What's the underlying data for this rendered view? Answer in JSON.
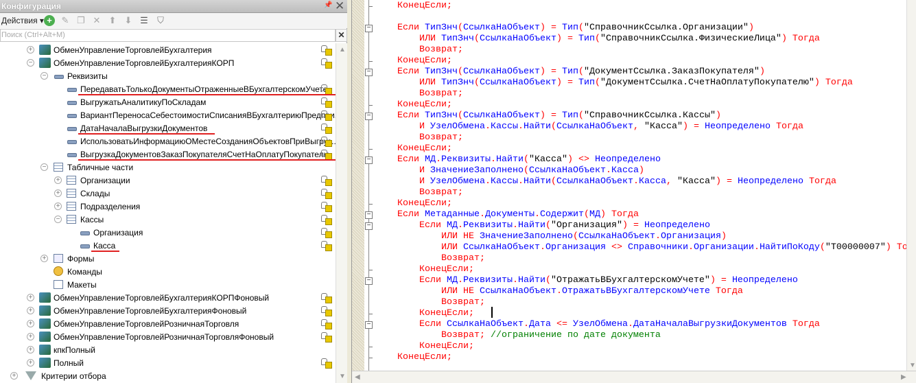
{
  "panel": {
    "title": "Конфигурация",
    "actions_label": "Действия ▾",
    "search_placeholder": "Поиск (Ctrl+Alt+M)",
    "toolbar_icons": [
      "add-icon",
      "edit-icon",
      "copy-icon",
      "delete-icon",
      "move-up-icon",
      "move-down-icon",
      "sort-icon",
      "filter-icon"
    ]
  },
  "tree": [
    {
      "label": "ОбменУправлениеТорговлейБухгалтерия",
      "level": 0,
      "expander": "plus",
      "icon": "exch",
      "lock": true
    },
    {
      "label": "ОбменУправлениеТорговлейБухгалтерияКОРП",
      "level": 0,
      "expander": "minus",
      "icon": "exch",
      "lock": true
    },
    {
      "label": "Реквизиты",
      "level": 1,
      "expander": "minus",
      "icon": "attr",
      "lock": false
    },
    {
      "label": "ПередаватьТолькоДокументыОтраженныеВБухгалтерскомУчете",
      "level": 2,
      "expander": "none",
      "icon": "attr",
      "lock": true,
      "highlight": true
    },
    {
      "label": "ВыгружатьАналитикуПоСкладам",
      "level": 2,
      "expander": "none",
      "icon": "attr",
      "lock": true
    },
    {
      "label": "ВариантПереносаСебестоимостиСписанияВБухгалтериюПредпри...",
      "level": 2,
      "expander": "none",
      "icon": "attr",
      "lock": true
    },
    {
      "label": "ДатаНачалаВыгрузкиДокументов",
      "level": 2,
      "expander": "none",
      "icon": "attr",
      "lock": true,
      "highlight": true
    },
    {
      "label": "ИспользоватьИнформациюОМестеСозданияОбъектовПриВыгруз...",
      "level": 2,
      "expander": "none",
      "icon": "attr",
      "lock": true
    },
    {
      "label": "ВыгрузкаДокументовЗаказПокупателяСчетНаОплатуПокупателю",
      "level": 2,
      "expander": "none",
      "icon": "attr",
      "lock": true,
      "highlight": true
    },
    {
      "label": "Табличные части",
      "level": 1,
      "expander": "minus",
      "icon": "tbl",
      "lock": false
    },
    {
      "label": "Организации",
      "level": 2,
      "expander": "plus",
      "icon": "tbl",
      "lock": true
    },
    {
      "label": "Склады",
      "level": 2,
      "expander": "plus",
      "icon": "tbl",
      "lock": true
    },
    {
      "label": "Подразделения",
      "level": 2,
      "expander": "plus",
      "icon": "tbl",
      "lock": true
    },
    {
      "label": "Кассы",
      "level": 2,
      "expander": "minus",
      "icon": "tbl",
      "lock": true
    },
    {
      "label": "Организация",
      "level": 3,
      "expander": "none",
      "icon": "attr",
      "lock": true
    },
    {
      "label": "Касса",
      "level": 3,
      "expander": "none",
      "icon": "attr",
      "lock": true,
      "highlight": true
    },
    {
      "label": "Формы",
      "level": 1,
      "expander": "plus",
      "icon": "form",
      "lock": false
    },
    {
      "label": "Команды",
      "level": 1,
      "expander": "none",
      "icon": "cmd",
      "lock": false
    },
    {
      "label": "Макеты",
      "level": 1,
      "expander": "none",
      "icon": "tpl",
      "lock": false
    },
    {
      "label": "ОбменУправлениеТорговлейБухгалтерияКОРПФоновый",
      "level": 0,
      "expander": "plus",
      "icon": "exch",
      "lock": true
    },
    {
      "label": "ОбменУправлениеТорговлейБухгалтерияФоновый",
      "level": 0,
      "expander": "plus",
      "icon": "exch",
      "lock": true
    },
    {
      "label": "ОбменУправлениеТорговлейРозничнаяТорговля",
      "level": 0,
      "expander": "plus",
      "icon": "exch",
      "lock": true
    },
    {
      "label": "ОбменУправлениеТорговлейРозничнаяТорговляФоновый",
      "level": 0,
      "expander": "plus",
      "icon": "exch",
      "lock": true
    },
    {
      "label": "кпкПолный",
      "level": 0,
      "expander": "plus",
      "icon": "exch",
      "lock": false
    },
    {
      "label": "Полный",
      "level": 0,
      "expander": "plus",
      "icon": "exch",
      "lock": true
    },
    {
      "label": "Критерии отбора",
      "level": -1,
      "expander": "plus",
      "icon": "flt",
      "lock": false
    }
  ],
  "code": [
    {
      "indent": 1,
      "fold": "end",
      "t": [
        [
          "k",
          "КонецЕсли;"
        ]
      ]
    },
    {
      "indent": 0,
      "fold": "",
      "t": []
    },
    {
      "indent": 1,
      "fold": "start",
      "t": [
        [
          "k",
          "Если "
        ],
        [
          "i",
          "ТипЗнч"
        ],
        [
          "k",
          "("
        ],
        [
          "i",
          "СсылкаНаОбъект"
        ],
        [
          "k",
          ") = "
        ],
        [
          "i",
          "Тип"
        ],
        [
          "k",
          "("
        ],
        [
          "s",
          "\"СправочникСсылка.Организации\""
        ],
        [
          "k",
          ")"
        ]
      ]
    },
    {
      "indent": 2,
      "fold": "",
      "t": [
        [
          "k",
          "ИЛИ "
        ],
        [
          "i",
          "ТипЗнч"
        ],
        [
          "k",
          "("
        ],
        [
          "i",
          "СсылкаНаОбъект"
        ],
        [
          "k",
          ") = "
        ],
        [
          "i",
          "Тип"
        ],
        [
          "k",
          "("
        ],
        [
          "s",
          "\"СправочникСсылка.ФизическиеЛица\""
        ],
        [
          "k",
          ") Тогда"
        ]
      ]
    },
    {
      "indent": 2,
      "fold": "",
      "t": [
        [
          "k",
          "Возврат;"
        ]
      ]
    },
    {
      "indent": 1,
      "fold": "end",
      "t": [
        [
          "k",
          "КонецЕсли;"
        ]
      ]
    },
    {
      "indent": 1,
      "fold": "start",
      "t": [
        [
          "k",
          "Если "
        ],
        [
          "i",
          "ТипЗнч"
        ],
        [
          "k",
          "("
        ],
        [
          "i",
          "СсылкаНаОбъект"
        ],
        [
          "k",
          ") = "
        ],
        [
          "i",
          "Тип"
        ],
        [
          "k",
          "("
        ],
        [
          "s",
          "\"ДокументСсылка.ЗаказПокупателя\""
        ],
        [
          "k",
          ")"
        ]
      ]
    },
    {
      "indent": 2,
      "fold": "",
      "t": [
        [
          "k",
          "ИЛИ "
        ],
        [
          "i",
          "ТипЗнч"
        ],
        [
          "k",
          "("
        ],
        [
          "i",
          "СсылкаНаОбъект"
        ],
        [
          "k",
          ") = "
        ],
        [
          "i",
          "Тип"
        ],
        [
          "k",
          "("
        ],
        [
          "s",
          "\"ДокументСсылка.СчетНаОплатуПокупателю\""
        ],
        [
          "k",
          ") Тогда"
        ]
      ]
    },
    {
      "indent": 2,
      "fold": "",
      "t": [
        [
          "k",
          "Возврат;"
        ]
      ]
    },
    {
      "indent": 1,
      "fold": "end",
      "t": [
        [
          "k",
          "КонецЕсли;"
        ]
      ]
    },
    {
      "indent": 1,
      "fold": "start",
      "t": [
        [
          "k",
          "Если "
        ],
        [
          "i",
          "ТипЗнч"
        ],
        [
          "k",
          "("
        ],
        [
          "i",
          "СсылкаНаОбъект"
        ],
        [
          "k",
          ") = "
        ],
        [
          "i",
          "Тип"
        ],
        [
          "k",
          "("
        ],
        [
          "s",
          "\"СправочникСсылка.Кассы\""
        ],
        [
          "k",
          ")"
        ]
      ]
    },
    {
      "indent": 2,
      "fold": "",
      "t": [
        [
          "k",
          "И "
        ],
        [
          "i",
          "УзелОбмена"
        ],
        [
          "k",
          "."
        ],
        [
          "i",
          "Кассы"
        ],
        [
          "k",
          "."
        ],
        [
          "i",
          "Найти"
        ],
        [
          "k",
          "("
        ],
        [
          "i",
          "СсылкаНаОбъект"
        ],
        [
          "k",
          ", "
        ],
        [
          "s",
          "\"Касса\""
        ],
        [
          "k",
          ") = "
        ],
        [
          "i",
          "Неопределено"
        ],
        [
          "k",
          " Тогда"
        ]
      ]
    },
    {
      "indent": 2,
      "fold": "",
      "t": [
        [
          "k",
          "Возврат;"
        ]
      ]
    },
    {
      "indent": 1,
      "fold": "end",
      "t": [
        [
          "k",
          "КонецЕсли;"
        ]
      ]
    },
    {
      "indent": 1,
      "fold": "start",
      "t": [
        [
          "k",
          "Если "
        ],
        [
          "i",
          "МД"
        ],
        [
          "k",
          "."
        ],
        [
          "i",
          "Реквизиты"
        ],
        [
          "k",
          "."
        ],
        [
          "i",
          "Найти"
        ],
        [
          "k",
          "("
        ],
        [
          "s",
          "\"Касса\""
        ],
        [
          "k",
          ") <> "
        ],
        [
          "i",
          "Неопределено"
        ]
      ]
    },
    {
      "indent": 2,
      "fold": "",
      "t": [
        [
          "k",
          "И "
        ],
        [
          "i",
          "ЗначениеЗаполнено"
        ],
        [
          "k",
          "("
        ],
        [
          "i",
          "СсылкаНаОбъект"
        ],
        [
          "k",
          "."
        ],
        [
          "i",
          "Касса"
        ],
        [
          "k",
          ")"
        ]
      ]
    },
    {
      "indent": 2,
      "fold": "",
      "t": [
        [
          "k",
          "И "
        ],
        [
          "i",
          "УзелОбмена"
        ],
        [
          "k",
          "."
        ],
        [
          "i",
          "Кассы"
        ],
        [
          "k",
          "."
        ],
        [
          "i",
          "Найти"
        ],
        [
          "k",
          "("
        ],
        [
          "i",
          "СсылкаНаОбъект"
        ],
        [
          "k",
          "."
        ],
        [
          "i",
          "Касса"
        ],
        [
          "k",
          ", "
        ],
        [
          "s",
          "\"Касса\""
        ],
        [
          "k",
          ") = "
        ],
        [
          "i",
          "Неопределено"
        ],
        [
          "k",
          " Тогда"
        ]
      ]
    },
    {
      "indent": 2,
      "fold": "",
      "t": [
        [
          "k",
          "Возврат;"
        ]
      ]
    },
    {
      "indent": 1,
      "fold": "end",
      "t": [
        [
          "k",
          "КонецЕсли;"
        ]
      ]
    },
    {
      "indent": 1,
      "fold": "start",
      "t": [
        [
          "k",
          "Если "
        ],
        [
          "i",
          "Метаданные"
        ],
        [
          "k",
          "."
        ],
        [
          "i",
          "Документы"
        ],
        [
          "k",
          "."
        ],
        [
          "i",
          "Содержит"
        ],
        [
          "k",
          "("
        ],
        [
          "i",
          "МД"
        ],
        [
          "k",
          ") Тогда"
        ]
      ]
    },
    {
      "indent": 2,
      "fold": "start",
      "t": [
        [
          "k",
          "Если "
        ],
        [
          "i",
          "МД"
        ],
        [
          "k",
          "."
        ],
        [
          "i",
          "Реквизиты"
        ],
        [
          "k",
          "."
        ],
        [
          "i",
          "Найти"
        ],
        [
          "k",
          "("
        ],
        [
          "s",
          "\"Организация\""
        ],
        [
          "k",
          ") = "
        ],
        [
          "i",
          "Неопределено"
        ]
      ]
    },
    {
      "indent": 3,
      "fold": "",
      "t": [
        [
          "k",
          "ИЛИ НЕ "
        ],
        [
          "i",
          "ЗначениеЗаполнено"
        ],
        [
          "k",
          "("
        ],
        [
          "i",
          "СсылкаНаОбъект"
        ],
        [
          "k",
          "."
        ],
        [
          "i",
          "Организация"
        ],
        [
          "k",
          ")"
        ]
      ]
    },
    {
      "indent": 3,
      "fold": "",
      "t": [
        [
          "k",
          "ИЛИ "
        ],
        [
          "i",
          "СсылкаНаОбъект"
        ],
        [
          "k",
          "."
        ],
        [
          "i",
          "Организация"
        ],
        [
          "k",
          " <> "
        ],
        [
          "i",
          "Справочники"
        ],
        [
          "k",
          "."
        ],
        [
          "i",
          "Организации"
        ],
        [
          "k",
          "."
        ],
        [
          "i",
          "НайтиПоКоду"
        ],
        [
          "k",
          "("
        ],
        [
          "s",
          "\"Т00000007\""
        ],
        [
          "k",
          ") То"
        ]
      ]
    },
    {
      "indent": 3,
      "fold": "",
      "t": [
        [
          "k",
          "Возврат;"
        ]
      ]
    },
    {
      "indent": 2,
      "fold": "end",
      "t": [
        [
          "k",
          "КонецЕсли;"
        ]
      ]
    },
    {
      "indent": 2,
      "fold": "start",
      "t": [
        [
          "k",
          "Если "
        ],
        [
          "i",
          "МД"
        ],
        [
          "k",
          "."
        ],
        [
          "i",
          "Реквизиты"
        ],
        [
          "k",
          "."
        ],
        [
          "i",
          "Найти"
        ],
        [
          "k",
          "("
        ],
        [
          "s",
          "\"ОтражатьВБухгалтерскомУчете\""
        ],
        [
          "k",
          ") = "
        ],
        [
          "i",
          "Неопределено"
        ]
      ]
    },
    {
      "indent": 3,
      "fold": "",
      "t": [
        [
          "k",
          "ИЛИ НЕ "
        ],
        [
          "i",
          "СсылкаНаОбъект"
        ],
        [
          "k",
          "."
        ],
        [
          "i",
          "ОтражатьВБухгалтерскомУчете"
        ],
        [
          "k",
          " Тогда"
        ]
      ]
    },
    {
      "indent": 3,
      "fold": "",
      "t": [
        [
          "k",
          "Возврат;"
        ]
      ]
    },
    {
      "indent": 2,
      "fold": "end",
      "t": [
        [
          "k",
          "КонецЕсли;"
        ]
      ]
    },
    {
      "indent": 2,
      "fold": "start",
      "t": [
        [
          "k",
          "Если "
        ],
        [
          "i",
          "СсылкаНаОбъект"
        ],
        [
          "k",
          "."
        ],
        [
          "i",
          "Дата"
        ],
        [
          "k",
          " <= "
        ],
        [
          "i",
          "УзелОбмена"
        ],
        [
          "k",
          "."
        ],
        [
          "i",
          "ДатаНачалаВыгрузкиДокументов"
        ],
        [
          "k",
          " Тогда"
        ]
      ]
    },
    {
      "indent": 3,
      "fold": "",
      "t": [
        [
          "k",
          "Возврат; "
        ],
        [
          "c",
          "//ограничение по дате документа"
        ]
      ]
    },
    {
      "indent": 2,
      "fold": "end",
      "t": [
        [
          "k",
          "КонецЕсли;"
        ]
      ]
    },
    {
      "indent": 1,
      "fold": "end",
      "t": [
        [
          "k",
          "КонецЕсли;"
        ]
      ]
    }
  ]
}
